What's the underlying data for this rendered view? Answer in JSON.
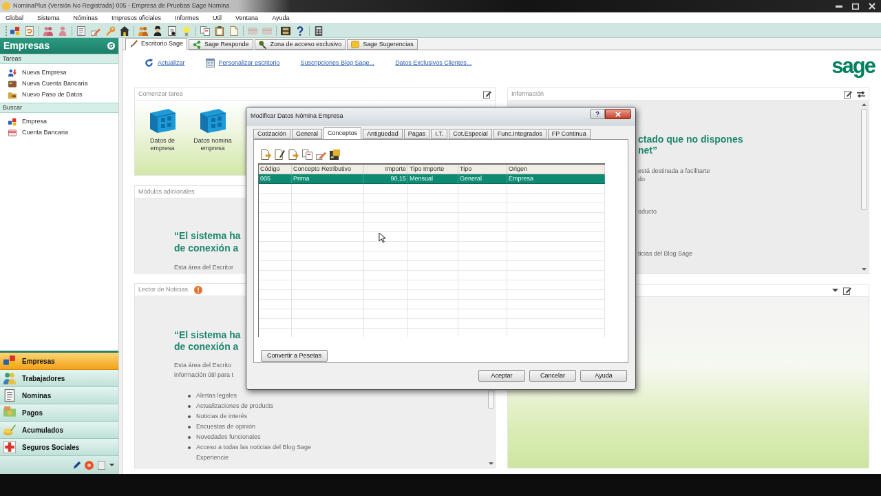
{
  "window": {
    "title": "NominaPlus (Versión No Registrada) 005 - Empresa de Pruebas Sage Nomina"
  },
  "menu": [
    "Global",
    "Sistema",
    "Nóminas",
    "Impresos oficiales",
    "Informes",
    "Util",
    "Ventana",
    "Ayuda"
  ],
  "toolbar": [
    [
      {
        "disabled": false
      },
      {
        "disabled": false
      }
    ],
    [
      {
        "disabled": false
      },
      {
        "disabled": false
      }
    ],
    [
      {
        "disabled": false
      },
      {
        "disabled": false
      },
      {
        "disabled": false
      },
      {
        "disabled": false
      }
    ],
    [
      {
        "disabled": false
      },
      {
        "disabled": false
      },
      {
        "disabled": false
      },
      {
        "disabled": false
      }
    ],
    [
      {
        "disabled": false
      },
      {
        "disabled": false
      },
      {
        "disabled": false
      }
    ],
    [
      {
        "disabled": true
      },
      {
        "disabled": true
      }
    ],
    [
      {
        "disabled": false
      },
      {
        "disabled": false
      }
    ],
    [
      {
        "disabled": false
      }
    ]
  ],
  "sidebar": {
    "title": "Empresas",
    "sections": [
      {
        "title": "Tareas",
        "items": [
          "Nueva Empresa",
          "Nueva Cuenta Bancaria",
          "Nuevo Paso de Datos"
        ]
      },
      {
        "title": "Buscar",
        "items": [
          "Empresa",
          "Cuenta Bancaria"
        ]
      }
    ],
    "nav": [
      {
        "label": "Empresas",
        "selected": true
      },
      {
        "label": "Trabajadores",
        "selected": false
      },
      {
        "label": "Nominas",
        "selected": false
      },
      {
        "label": "Pagos",
        "selected": false
      },
      {
        "label": "Acumulados",
        "selected": false
      },
      {
        "label": "Seguros Sociales",
        "selected": false
      }
    ]
  },
  "tabs": [
    {
      "label": "Escritorio Sage",
      "selected": true
    },
    {
      "label": "Sage Responde",
      "selected": false
    },
    {
      "label": "Zona de acceso exclusivo",
      "selected": false
    },
    {
      "label": "Sage Sugerencias",
      "selected": false
    }
  ],
  "links": [
    "Actualizar",
    "Personalizar escritorio",
    "Suscripciones Blog Sage...",
    "Datos Exclusivos Clientes..."
  ],
  "logo": "sage",
  "start_task": {
    "title": "Comenzar tarea",
    "tiles": [
      "Datos de empresa",
      "Datos nomina empresa"
    ]
  },
  "modules": {
    "title": "Módulos adicionales",
    "headline": [
      "“El sistema ha",
      "de conexión a"
    ],
    "text": [
      "Esta área del Escritor"
    ]
  },
  "news": {
    "title": "Lector de Noticias",
    "headline": [
      "“El sistema ha",
      "de conexión a"
    ],
    "text": [
      "Esta área del Escrito",
      "información útil para t"
    ],
    "bullets": [
      "Alertas legales",
      "Actualizaciones de products",
      "Noticias de interés",
      "Encuestas de opinión",
      "Novedades funcionales",
      "Acceso a todas las noticias del Blog Sage Experiencie"
    ]
  },
  "info": {
    "title": "Información",
    "headline": [
      "ctado que no dispones",
      "net”"
    ],
    "text": [
      "está destinada a facilitarte",
      "do",
      "oducto",
      "ticias del Blog Sage"
    ]
  },
  "dialog": {
    "title": "Modificar Datos Nómina Empresa",
    "tabs": [
      {
        "label": "Cotización",
        "selected": false
      },
      {
        "label": "General",
        "selected": false
      },
      {
        "label": "Conceptos",
        "selected": true
      },
      {
        "label": "Antigüedad",
        "selected": false
      },
      {
        "label": "Pagas",
        "selected": false
      },
      {
        "label": "I.T.",
        "selected": false
      },
      {
        "label": "Cot.Especial",
        "selected": false
      },
      {
        "label": "Func.Integrados",
        "selected": false
      },
      {
        "label": "FP Continua",
        "selected": false
      }
    ],
    "grid": {
      "columns": [
        {
          "label": "Código",
          "kind": "text"
        },
        {
          "label": "Concepto Retributivo",
          "kind": "text"
        },
        {
          "label": "Importe",
          "kind": "number"
        },
        {
          "label": "Tipo Importe",
          "kind": "text"
        },
        {
          "label": "Tipo",
          "kind": "text"
        },
        {
          "label": "Origen",
          "kind": "text"
        }
      ],
      "rows": [
        {
          "cells": [
            "005",
            "Prima",
            "90,15",
            "Mensual",
            "General",
            "Empresa"
          ],
          "selected": true
        }
      ]
    },
    "convert_button": "Convertir a Pesetas",
    "buttons": [
      "Aceptar",
      "Cancelar",
      "Ayuda"
    ]
  }
}
